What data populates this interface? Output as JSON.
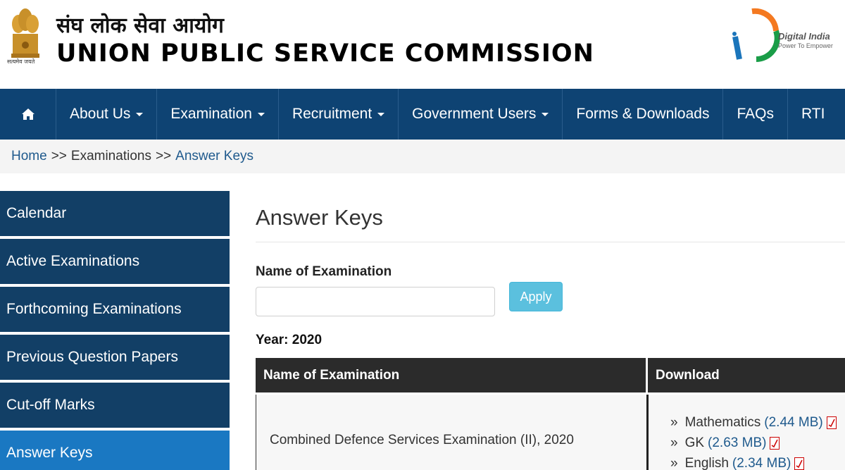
{
  "header": {
    "hindi_title": "संघ लोक सेवा आयोग",
    "english_title": "UNION PUBLIC SERVICE COMMISSION",
    "emblem_caption": "सत्यमेव जयते",
    "digital_india": {
      "title": "Digital India",
      "tagline": "Power To Empower"
    }
  },
  "nav": {
    "items": [
      {
        "label": "About Us",
        "dropdown": true
      },
      {
        "label": "Examination",
        "dropdown": true
      },
      {
        "label": "Recruitment",
        "dropdown": true
      },
      {
        "label": "Government Users",
        "dropdown": true
      },
      {
        "label": "Forms & Downloads",
        "dropdown": false
      },
      {
        "label": "FAQs",
        "dropdown": false
      },
      {
        "label": "RTI",
        "dropdown": false
      }
    ]
  },
  "breadcrumb": {
    "home": "Home",
    "sep1": ">>",
    "examinations": "Examinations",
    "sep2": ">>",
    "current": "Answer Keys"
  },
  "sidebar": {
    "items": [
      {
        "label": "Calendar"
      },
      {
        "label": "Active Examinations"
      },
      {
        "label": "Forthcoming Examinations"
      },
      {
        "label": "Previous Question Papers"
      },
      {
        "label": "Cut-off Marks"
      },
      {
        "label": "Answer Keys"
      }
    ]
  },
  "main": {
    "title": "Answer Keys",
    "filter_label": "Name of Examination",
    "exam_input": {
      "value": "",
      "placeholder": ""
    },
    "apply_label": "Apply",
    "year_label": "Year: 2020",
    "table": {
      "headers": [
        "Name of Examination",
        "Download"
      ],
      "rows": [
        {
          "exam": "Combined Defence Services Examination (II), 2020",
          "downloads": [
            {
              "raquo": "»",
              "subject": "Mathematics",
              "size": "(2.44 MB)"
            },
            {
              "raquo": "»",
              "subject": "GK",
              "size": "(2.63 MB)"
            },
            {
              "raquo": "»",
              "subject": "English",
              "size": "(2.34 MB)"
            }
          ]
        }
      ]
    }
  },
  "colors": {
    "nav_bg": "#0e4373",
    "sidebar_bg": "#123f66",
    "sidebar_active": "#1a78c2",
    "apply_bg": "#5bc0de",
    "link": "#1f5a8d"
  }
}
